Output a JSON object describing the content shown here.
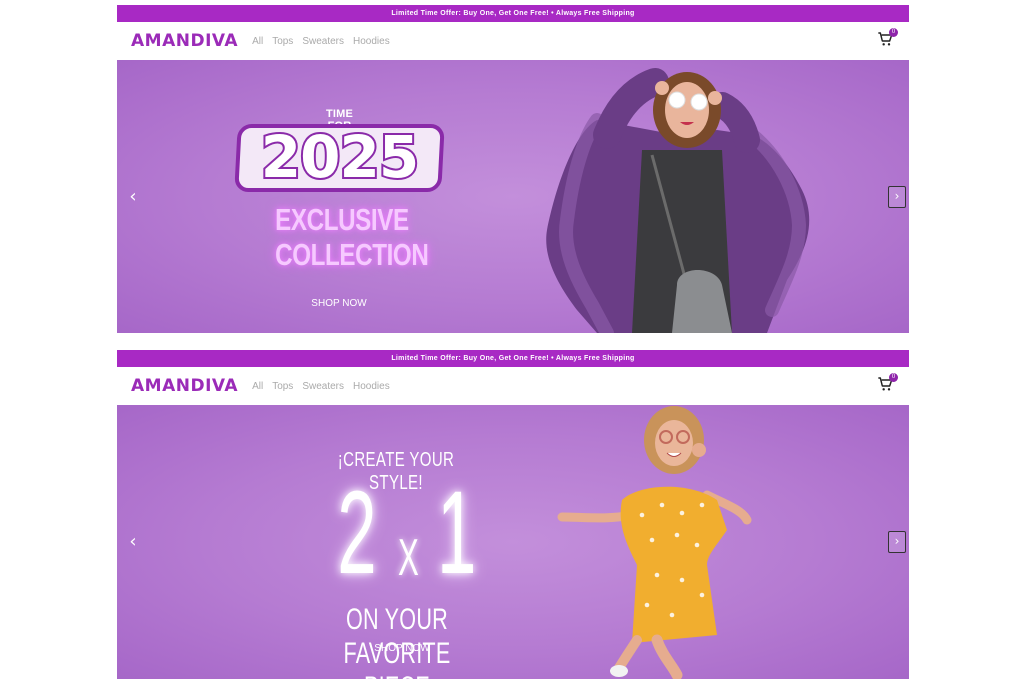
{
  "promo_text": "Limited Time Offer: Buy One, Get One Free! • Always Free Shipping",
  "brand": "AMANDIVA",
  "nav": [
    "All",
    "Tops",
    "Sweaters",
    "Hoodies"
  ],
  "cart": {
    "count": "0",
    "icon": "cart-icon"
  },
  "arrows": {
    "prev": "‹",
    "next": "›"
  },
  "banner1": {
    "time_for": "TIME FOR",
    "year": "2025",
    "headline_1": "EXCLUSIVE",
    "headline_2": "COLLECTION",
    "cta": "SHOP NOW"
  },
  "banner2": {
    "tagline": "¡CREATE YOUR STYLE!",
    "offer_2": "2",
    "offer_x": "X",
    "offer_1": "1",
    "subline": "ON YOUR FAVORITE PIECE",
    "cta": "SHOP NOW"
  },
  "colors": {
    "accent": "#a829c4",
    "brand": "#9b2bb8",
    "hero_bg": "#b57bd2"
  }
}
